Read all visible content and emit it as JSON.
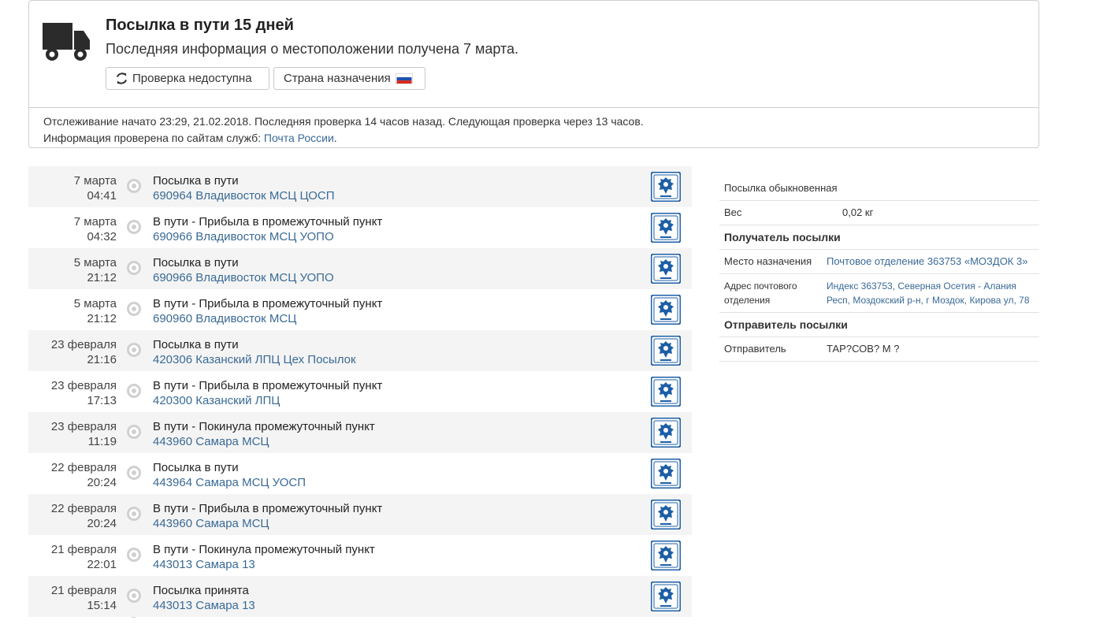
{
  "status": {
    "title": "Посылка в пути 15 дней",
    "subtitle": "Последняя информация о местоположении получена 7 марта.",
    "check_button": "Проверка недоступна",
    "country_button": "Страна назначения",
    "tracking_info": "Отслеживание начато 23:29, 21.02.2018. Последняя проверка 14 часов назад. Следующая проверка через 13 часов.",
    "verified_prefix": "Информация проверена по сайтам служб: ",
    "service_link": "Почта России",
    "verified_suffix": "."
  },
  "events": [
    {
      "date": "7 марта",
      "time": "04:41",
      "status": "Посылка в пути",
      "place": "690964 Владивосток МСЦ ЦОСП"
    },
    {
      "date": "7 марта",
      "time": "04:32",
      "status": "В пути - Прибыла в промежуточный пункт",
      "place": "690966 Владивосток МСЦ УОПО"
    },
    {
      "date": "5 марта",
      "time": "21:12",
      "status": "Посылка в пути",
      "place": "690966 Владивосток МСЦ УОПО"
    },
    {
      "date": "5 марта",
      "time": "21:12",
      "status": "В пути - Прибыла в промежуточный пункт",
      "place": "690960 Владивосток МСЦ"
    },
    {
      "date": "23 февраля",
      "time": "21:16",
      "status": "Посылка в пути",
      "place": "420306 Казанский ЛПЦ Цех Посылок"
    },
    {
      "date": "23 февраля",
      "time": "17:13",
      "status": "В пути - Прибыла в промежуточный пункт",
      "place": "420300 Казанский ЛПЦ"
    },
    {
      "date": "23 февраля",
      "time": "11:19",
      "status": "В пути - Покинула промежуточный пункт",
      "place": "443960 Самара МСЦ"
    },
    {
      "date": "22 февраля",
      "time": "20:24",
      "status": "Посылка в пути",
      "place": "443964 Самара МСЦ УОСП"
    },
    {
      "date": "22 февраля",
      "time": "20:24",
      "status": "В пути - Прибыла в промежуточный пункт",
      "place": "443960 Самара МСЦ"
    },
    {
      "date": "21 февраля",
      "time": "22:01",
      "status": "В пути - Покинула промежуточный пункт",
      "place": "443013 Самара 13"
    },
    {
      "date": "21 февраля",
      "time": "15:14",
      "status": "Посылка принята",
      "place": "443013 Самара 13"
    }
  ],
  "info": {
    "parcel_type": "Посылка обыкновенная",
    "weight_label": "Вес",
    "weight_value": "0,02 кг",
    "recipient_heading": "Получатель посылки",
    "destination_label": "Место назначения",
    "destination_value": "Почтовое отделение 363753 «МОЗДОК 3»",
    "address_label": "Адрес почтового отделения",
    "address_value": "Индекс 363753, Северная Осетия - Алания Респ, Моздокский р-н, г Моздок, Кирова ул, 78",
    "sender_heading": "Отправитель посылки",
    "sender_label": "Отправитель",
    "sender_value": "ТАР?СОВ? М ?"
  },
  "colors": {
    "link": "#3a6a96",
    "post_logo": "#1d5fa6",
    "flag": [
      "#ffffff",
      "#1f4fb0",
      "#d52b1e"
    ]
  },
  "icons": [
    "truck-icon",
    "refresh-icon",
    "russia-flag-icon",
    "russian-post-logo-icon"
  ]
}
